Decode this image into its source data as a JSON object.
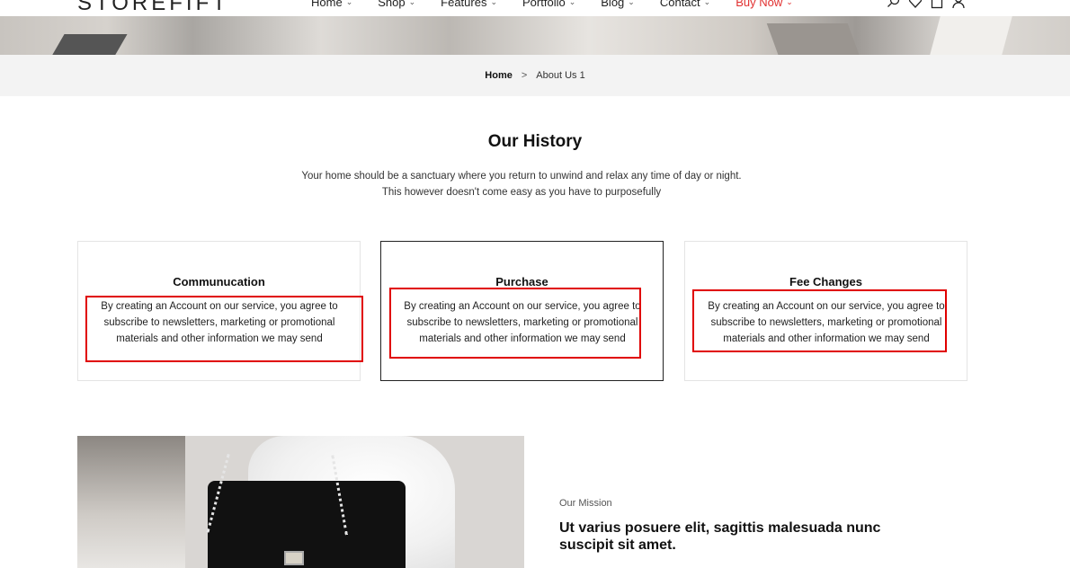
{
  "header": {
    "logo": "STOREFIFT",
    "nav": [
      {
        "label": "Home",
        "chevron": "⌄"
      },
      {
        "label": "Shop",
        "chevron": "⌄"
      },
      {
        "label": "Features",
        "chevron": "⌄"
      },
      {
        "label": "Portfolio",
        "chevron": "⌄"
      },
      {
        "label": "Blog",
        "chevron": "⌄"
      },
      {
        "label": "Contact",
        "chevron": "⌄"
      },
      {
        "label": "Buy Now",
        "chevron": "⌄"
      }
    ],
    "icons": [
      "search-icon",
      "heart-icon",
      "bag-icon",
      "user-icon"
    ],
    "buy_color": "#e12f2f"
  },
  "breadcrumb": {
    "home": "Home",
    "separator": ">",
    "current": "About Us 1"
  },
  "history": {
    "title": "Our History",
    "description": "Your home should be a sanctuary where you return to unwind and relax any time of day or night. This however doesn't come easy as you have to purposefully"
  },
  "cards": [
    {
      "title": "Communucation",
      "body": "By creating an Account on our service, you agree to subscribe to newsletters, marketing or promotional materials and other information we may send"
    },
    {
      "title": "Purchase",
      "body": "By creating an Account on our service, you agree to subscribe to newsletters, marketing or promotional materials and other information we may send"
    },
    {
      "title": "Fee Changes",
      "body": "By creating an Account on our service, you agree to subscribe to newsletters, marketing or promotional materials and other information we may send"
    }
  ],
  "highlight_color": "#e00000",
  "mission": {
    "kicker": "Our Mission",
    "title": "Ut varius posuere elit, sagittis malesuada nunc suscipit sit amet."
  }
}
